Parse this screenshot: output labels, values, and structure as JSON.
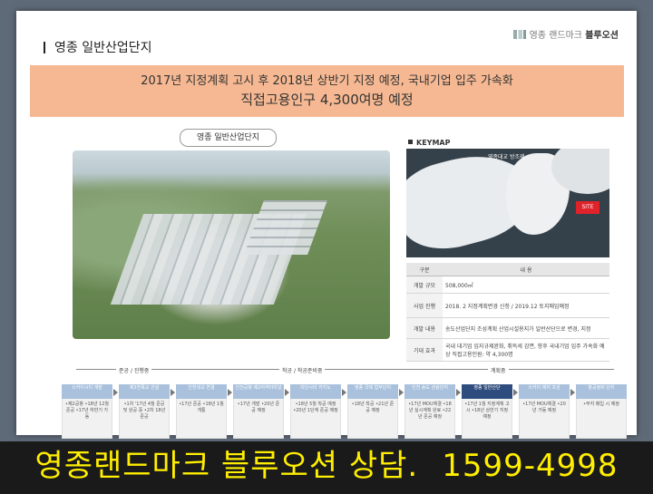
{
  "brand": {
    "name_light": "영종 랜드마크",
    "name_bold": "블루오션"
  },
  "title": "영종 일반산업단지",
  "banner": {
    "line1": "2017년 지정계획 고시 후 2018년 상반기 지정 예정, 국내기업 입주 가속화",
    "line2": "직접고용인구 4,300여명 예정"
  },
  "aerial": {
    "caption": "영종 일반산업단지"
  },
  "keymap": {
    "label": "KEYMAP",
    "top_label": "영종대교 방조제",
    "site_label": "SITE"
  },
  "info_table": {
    "headers": [
      "구분",
      "내 용"
    ],
    "rows": [
      {
        "key": "개발 규모",
        "value": "508,000㎡"
      },
      {
        "key": "사업 진행",
        "value": "2018. 2 지정계획변경 신청 / 2019.12 토지매입예정"
      },
      {
        "key": "개발 내용",
        "value": "송도산업단지 조성계획 산업시설용지가 일반산단으로 변경, 지정"
      },
      {
        "key": "기대 효과",
        "value": "국내 대기업 입지규제완화, 취득세 감면, 향후 국내기업 입주 가속화 예상 직접고용인원: 약 4,300명"
      }
    ]
  },
  "timeline": {
    "phases": [
      "준공 / 진행중",
      "착공 / 착공준비중",
      "계획중"
    ],
    "steps": [
      {
        "title": "스카이시티 개발",
        "body": "•제2공항 •18년 12월 준공 •17년 하반기 가동"
      },
      {
        "title": "제3연륙교 건설",
        "body": "•1차 '17년 4월 준공 및 완공 중 •2차 18년 준공"
      },
      {
        "title": "인천대교 연결",
        "body": "•17년 준공 •18년 1월 개통"
      },
      {
        "title": "인천공항 제2여객터미널",
        "body": "•17년 개발 •20년 준공 예정"
      },
      {
        "title": "미단시티 카지노",
        "body": "•18년 5월 착공 예정 •20년 1단계 준공 예정"
      },
      {
        "title": "영종 국제 업무단지",
        "body": "•18년 착공 •21년 준공 예정"
      },
      {
        "title": "인천 송도 관광단지",
        "body": "•17년 MOU체결 •18년 실시계획 완료 •22년 준공 예정"
      },
      {
        "title": "영종 일반산단",
        "body": "•17년 1월 지정계획 고시 •18년 상반기 지정 예정"
      },
      {
        "title": "스카이 레저 조성",
        "body": "•17년 MOU체결 •20년 가동 예정"
      },
      {
        "title": "항공정비 단지",
        "body": "•부지 매입 시 예정"
      }
    ]
  },
  "footer": {
    "text": "영종랜드마크 블루오션 상담.",
    "phone": "1599-4998"
  },
  "colors": {
    "banner": "#f6b892",
    "footer_bg": "#1a1a1a",
    "footer_text": "#ffee00",
    "step_active": "#2f4c7e",
    "step": "#a9c1dc"
  }
}
